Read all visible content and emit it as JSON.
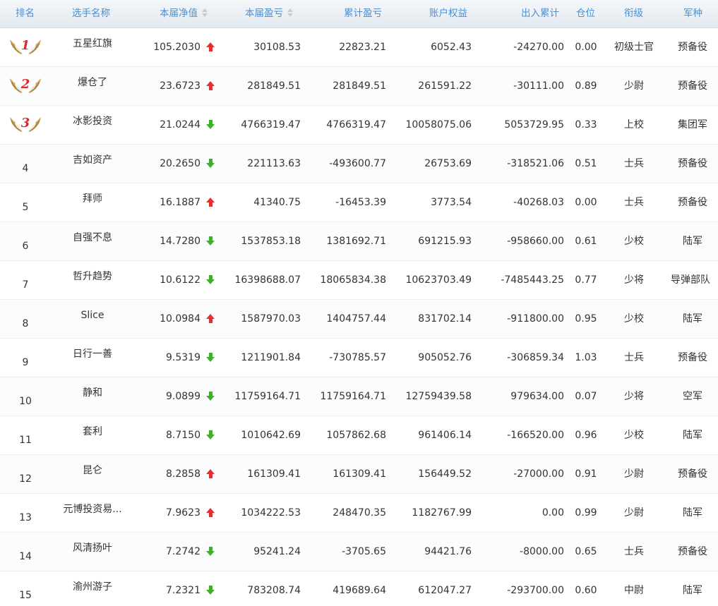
{
  "colors": {
    "header_text": "#4a8fd4",
    "up": "#e03131",
    "down": "#3fae2a",
    "medal_number": "#e02828"
  },
  "headers": {
    "rank": "排名",
    "name": "选手名称",
    "nav": "本届净值",
    "profit": "本届盈亏",
    "cum_profit": "累计盈亏",
    "equity": "账户权益",
    "flow": "出入累计",
    "position": "仓位",
    "title": "衔级",
    "army": "军种"
  },
  "sortable": [
    "nav",
    "profit"
  ],
  "rows": [
    {
      "rank": "1",
      "medal": true,
      "name": "五星红旗",
      "nav": "105.2030",
      "trend": "up",
      "profit": "30108.53",
      "cum_profit": "22823.21",
      "equity": "6052.43",
      "flow": "-24270.00",
      "position": "0.00",
      "title": "初级士官",
      "army": "预备役"
    },
    {
      "rank": "2",
      "medal": true,
      "name": "爆仓了",
      "nav": "23.6723",
      "trend": "up",
      "profit": "281849.51",
      "cum_profit": "281849.51",
      "equity": "261591.22",
      "flow": "-30111.00",
      "position": "0.89",
      "title": "少尉",
      "army": "预备役"
    },
    {
      "rank": "3",
      "medal": true,
      "name": "冰影投资",
      "nav": "21.0244",
      "trend": "down",
      "profit": "4766319.47",
      "cum_profit": "4766319.47",
      "equity": "10058075.06",
      "flow": "5053729.95",
      "position": "0.33",
      "title": "上校",
      "army": "集团军"
    },
    {
      "rank": "4",
      "medal": false,
      "name": "吉如资产",
      "nav": "20.2650",
      "trend": "down",
      "profit": "221113.63",
      "cum_profit": "-493600.77",
      "equity": "26753.69",
      "flow": "-318521.06",
      "position": "0.51",
      "title": "士兵",
      "army": "预备役"
    },
    {
      "rank": "5",
      "medal": false,
      "name": "拜师",
      "nav": "16.1887",
      "trend": "up",
      "profit": "41340.75",
      "cum_profit": "-16453.39",
      "equity": "3773.54",
      "flow": "-40268.03",
      "position": "0.00",
      "title": "士兵",
      "army": "预备役"
    },
    {
      "rank": "6",
      "medal": false,
      "name": "自强不息",
      "nav": "14.7280",
      "trend": "down",
      "profit": "1537853.18",
      "cum_profit": "1381692.71",
      "equity": "691215.93",
      "flow": "-958660.00",
      "position": "0.61",
      "title": "少校",
      "army": "陆军"
    },
    {
      "rank": "7",
      "medal": false,
      "name": "哲升趋势",
      "nav": "10.6122",
      "trend": "down",
      "profit": "16398688.07",
      "cum_profit": "18065834.38",
      "equity": "10623703.49",
      "flow": "-7485443.25",
      "position": "0.77",
      "title": "少将",
      "army": "导弹部队"
    },
    {
      "rank": "8",
      "medal": false,
      "name": "Slice",
      "nav": "10.0984",
      "trend": "up",
      "profit": "1587970.03",
      "cum_profit": "1404757.44",
      "equity": "831702.14",
      "flow": "-911800.00",
      "position": "0.95",
      "title": "少校",
      "army": "陆军"
    },
    {
      "rank": "9",
      "medal": false,
      "name": "日行一善",
      "nav": "9.5319",
      "trend": "down",
      "profit": "1211901.84",
      "cum_profit": "-730785.57",
      "equity": "905052.76",
      "flow": "-306859.34",
      "position": "1.03",
      "title": "士兵",
      "army": "预备役"
    },
    {
      "rank": "10",
      "medal": false,
      "name": "静和",
      "nav": "9.0899",
      "trend": "down",
      "profit": "11759164.71",
      "cum_profit": "11759164.71",
      "equity": "12759439.58",
      "flow": "979634.00",
      "position": "0.07",
      "title": "少将",
      "army": "空军"
    },
    {
      "rank": "11",
      "medal": false,
      "name": "套利",
      "nav": "8.7150",
      "trend": "down",
      "profit": "1010642.69",
      "cum_profit": "1057862.68",
      "equity": "961406.14",
      "flow": "-166520.00",
      "position": "0.96",
      "title": "少校",
      "army": "陆军"
    },
    {
      "rank": "12",
      "medal": false,
      "name": "昆仑",
      "nav": "8.2858",
      "trend": "up",
      "profit": "161309.41",
      "cum_profit": "161309.41",
      "equity": "156449.52",
      "flow": "-27000.00",
      "position": "0.91",
      "title": "少尉",
      "army": "预备役"
    },
    {
      "rank": "13",
      "medal": false,
      "name": "元博投资易...",
      "nav": "7.9623",
      "trend": "up",
      "profit": "1034222.53",
      "cum_profit": "248470.35",
      "equity": "1182767.99",
      "flow": "0.00",
      "position": "0.99",
      "title": "少尉",
      "army": "陆军"
    },
    {
      "rank": "14",
      "medal": false,
      "name": "风清扬叶",
      "nav": "7.2742",
      "trend": "down",
      "profit": "95241.24",
      "cum_profit": "-3705.65",
      "equity": "94421.76",
      "flow": "-8000.00",
      "position": "0.65",
      "title": "士兵",
      "army": "预备役"
    },
    {
      "rank": "15",
      "medal": false,
      "name": "渝州游子",
      "nav": "7.2321",
      "trend": "down",
      "profit": "783208.74",
      "cum_profit": "419689.64",
      "equity": "612047.27",
      "flow": "-293700.00",
      "position": "0.60",
      "title": "中尉",
      "army": "陆军"
    }
  ]
}
